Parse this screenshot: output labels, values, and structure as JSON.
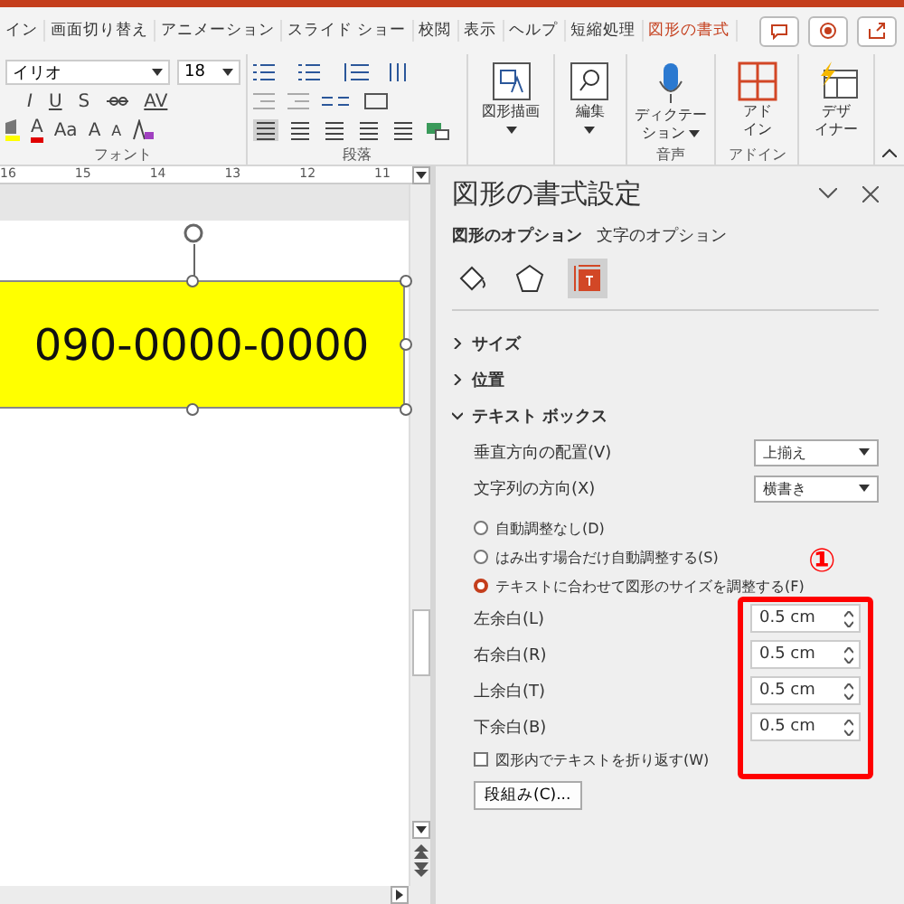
{
  "ribbon_tabs": [
    {
      "label": "イン",
      "selected": false
    },
    {
      "label": "画面切り替え",
      "selected": false
    },
    {
      "label": "アニメーション",
      "selected": false
    },
    {
      "label": "スライド ショー",
      "selected": false
    },
    {
      "label": "校閲",
      "selected": false
    },
    {
      "label": "表示",
      "selected": false
    },
    {
      "label": "ヘルプ",
      "selected": false
    },
    {
      "label": "短縮処理",
      "selected": false
    },
    {
      "label": "図形の書式",
      "selected": true
    }
  ],
  "ribbon": {
    "font_group": {
      "font_name": "イリオ",
      "font_size": "18",
      "row2": [
        "I",
        "U",
        "S"
      ],
      "spacing": "AV",
      "font_color": "A",
      "case": "Aa",
      "grow": "A",
      "shrink": "A",
      "label": "フォント"
    },
    "paragraph_group": {
      "label": "段落"
    },
    "big_buttons": [
      {
        "kind": "draw",
        "lines": [
          "図形描画"
        ],
        "caret": true
      },
      {
        "kind": "search",
        "lines": [
          "編集"
        ],
        "caret": true
      },
      {
        "kind": "mic",
        "lines": [
          "ディクテー",
          "ション"
        ],
        "caret": true,
        "group": "音声"
      },
      {
        "kind": "addin",
        "lines": [
          "アド",
          "イン"
        ],
        "group": "アドイン"
      },
      {
        "kind": "designer",
        "lines": [
          "デザ",
          "イナー"
        ]
      }
    ]
  },
  "ruler": [
    "16",
    "15",
    "14",
    "13",
    "12",
    "11"
  ],
  "slide": {
    "shape_text": "090-0000-0000"
  },
  "panel": {
    "title": "図形の書式設定",
    "option_tabs": [
      {
        "label": "図形のオプション",
        "selected": true
      },
      {
        "label": "文字のオプション",
        "selected": false
      }
    ],
    "icon_tabs": [
      {
        "kind": "fill",
        "selected": false
      },
      {
        "kind": "shape",
        "selected": false
      },
      {
        "kind": "textbox",
        "selected": true
      }
    ],
    "sections": [
      {
        "label": "サイズ",
        "expanded": false
      },
      {
        "label": "位置",
        "expanded": false
      },
      {
        "label": "テキスト ボックス",
        "expanded": true
      }
    ],
    "selects": [
      {
        "label": "垂直方向の配置(V)",
        "value": "上揃え"
      },
      {
        "label": "文字列の方向(X)",
        "value": "横書き"
      }
    ],
    "radios": [
      {
        "label": "自動調整なし(D)",
        "selected": false
      },
      {
        "label": "はみ出す場合だけ自動調整する(S)",
        "selected": false
      },
      {
        "label": "テキストに合わせて図形のサイズを調整する(F)",
        "selected": true
      }
    ],
    "margins": [
      {
        "label": "左余白(L)",
        "value": "0.5 cm"
      },
      {
        "label": "右余白(R)",
        "value": "0.5 cm"
      },
      {
        "label": "上余白(T)",
        "value": "0.5 cm"
      },
      {
        "label": "下余白(B)",
        "value": "0.5 cm"
      }
    ],
    "wrap": {
      "label": "図形内でテキストを折り返す(W)",
      "checked": false
    },
    "columns_button": "段組み(C)..."
  },
  "annotation": {
    "number": "①"
  }
}
